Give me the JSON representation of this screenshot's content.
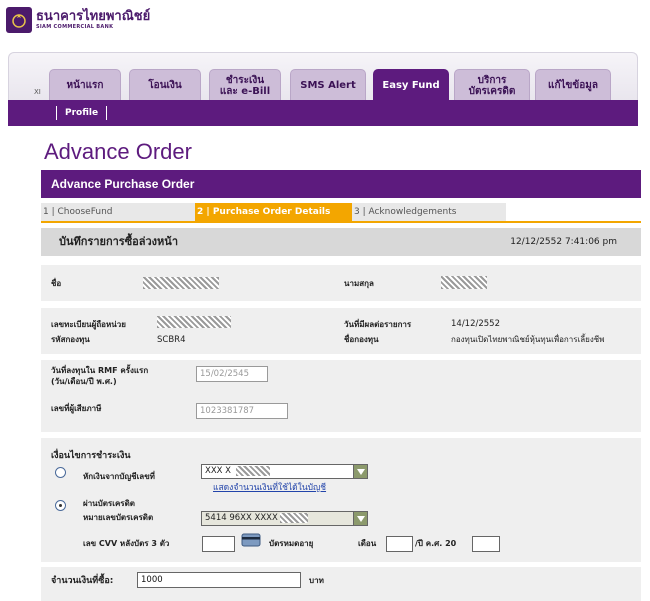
{
  "brand": {
    "name_th": "ธนาคารไทยพาณิชย์",
    "name_en": "SIAM COMMERCIAL BANK"
  },
  "tabs": [
    {
      "label": "หน้าแรก",
      "active": false
    },
    {
      "label": "โอนเงิน",
      "active": false
    },
    {
      "label": "ชำระเงิน\nและ e-Bill",
      "active": false
    },
    {
      "label": "SMS Alert",
      "active": false
    },
    {
      "label": "Easy Fund",
      "active": true
    },
    {
      "label": "บริการ\nบัตรเครดิต",
      "active": false
    },
    {
      "label": "แก้ไขข้อมูล",
      "active": false
    }
  ],
  "tab_marker": "XI",
  "subnav": {
    "profile": "Profile"
  },
  "page_title": "Advance Order",
  "section_title": "Advance Purchase Order",
  "steps": [
    {
      "label": "1 | ChooseFund",
      "active": false
    },
    {
      "label": "2 | Purchase Order Details",
      "active": true
    },
    {
      "label": "3 | Acknowledgements",
      "active": false
    }
  ],
  "record": {
    "title": "บันทึกรายการซื้อล่วงหน้า",
    "datetime": "12/12/2552  7:41:06 pm"
  },
  "customer": {
    "first_name_label": "ชื่อ",
    "last_name_label": "นามสกุล"
  },
  "fund": {
    "unitholder_label": "เลขทะเบียนผู้ถือหน่วย",
    "fund_code_label": "รหัสกองทุน",
    "fund_code": "SCBR4",
    "effective_date_label": "วันที่มีผลต่อรายการ",
    "effective_date": "14/12/2552",
    "fund_name_label": "ชื่อกองทุน",
    "fund_name": "กองทุนเปิดไทยพาณิชย์หุ้นทุนเพื่อการเลี้ยงชีพ"
  },
  "rmf": {
    "first_invest_label": "วันที่ลงทุนใน RMF ครั้งแรก",
    "first_invest_label2": "(วัน/เดือน/ปี พ.ศ.)",
    "first_invest_value": "15/02/2545",
    "tax_id_label": "เลขที่ผู้เสียภาษี",
    "tax_id_value": "1023381787"
  },
  "payment": {
    "heading": "เงื่อนไขการชำระเงิน",
    "option_account_label": "หักเงินจากบัญชีเลขที่",
    "account_value": "XXX X",
    "account_link": "แสดงจำนวนเงินที่ใช้ได้ในบัญชี",
    "option_card_label": "ผ่านบัตรเครดิต",
    "card_number_label": "หมายเลขบัตรเครดิต",
    "card_value": "5414 96XX XXXX",
    "cvv_label": "เลข CVV หลังบัตร 3 ตัว",
    "card_expiry_label": "บัตรหมดอายุ",
    "month_label": "เดือน",
    "year_label": "/ปี ค.ศ. 20"
  },
  "amount": {
    "label": "จำนวนเงินที่ซื้อ:",
    "value": "1000",
    "unit": "บาท"
  }
}
